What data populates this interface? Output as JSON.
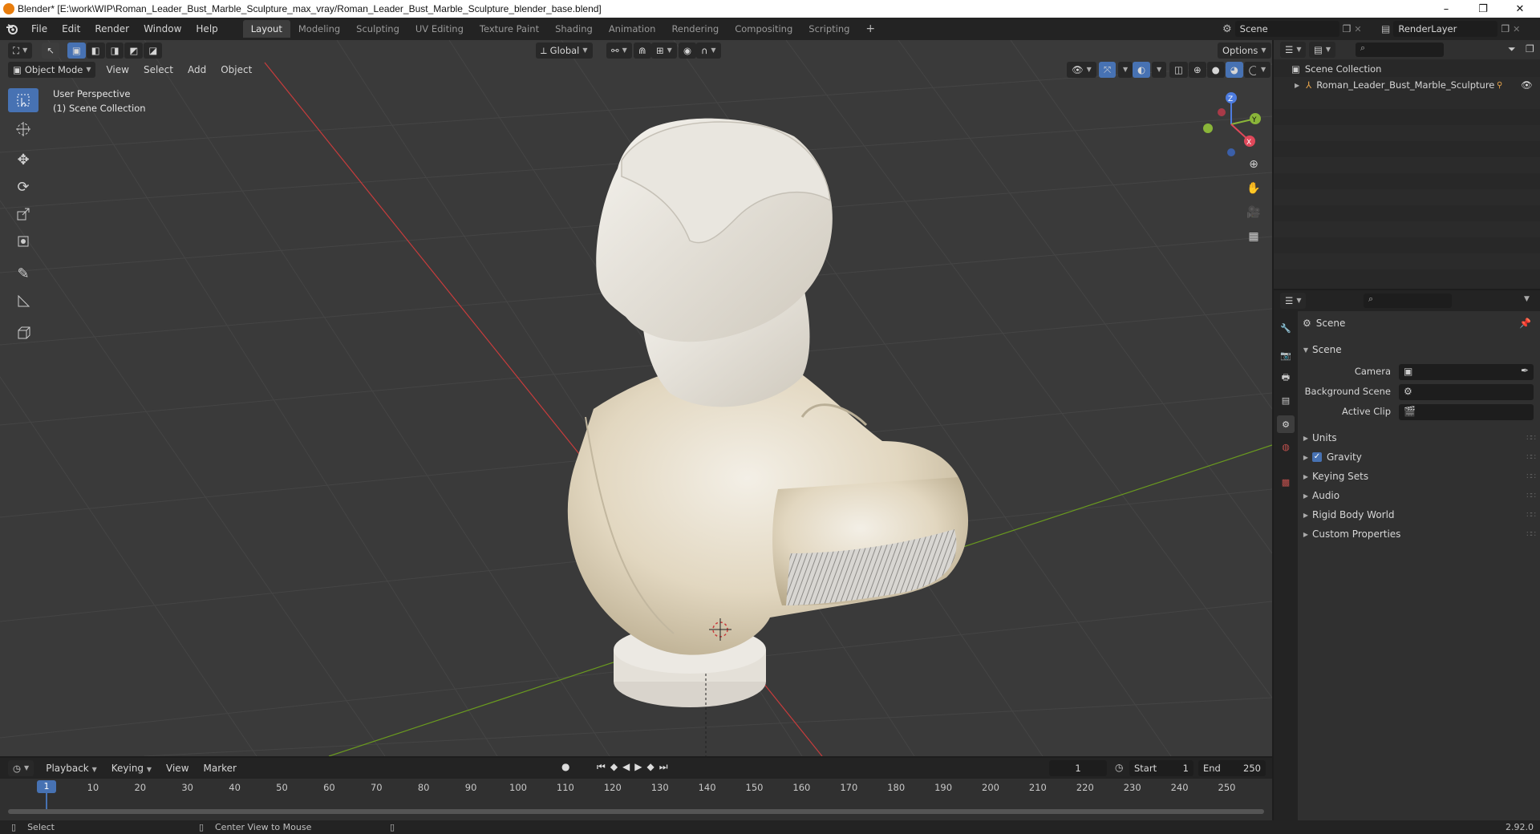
{
  "window": {
    "title": "Blender* [E:\\work\\WIP\\Roman_Leader_Bust_Marble_Sculpture_max_vray/Roman_Leader_Bust_Marble_Sculpture_blender_base.blend]",
    "minimize": "–",
    "maximize": "❐",
    "close": "✕"
  },
  "menubar": {
    "items": [
      "File",
      "Edit",
      "Render",
      "Window",
      "Help"
    ],
    "workspaces": [
      "Layout",
      "Modeling",
      "Sculpting",
      "UV Editing",
      "Texture Paint",
      "Shading",
      "Animation",
      "Rendering",
      "Compositing",
      "Scripting"
    ],
    "active_workspace": "Layout",
    "add_workspace": "+",
    "scene_name": "Scene",
    "render_layer": "RenderLayer"
  },
  "viewport": {
    "mode": "Object Mode",
    "menus": [
      "View",
      "Select",
      "Add",
      "Object"
    ],
    "orientation": "Global",
    "options_label": "Options",
    "overlay_text_1": "User Perspective",
    "overlay_text_2": "(1) Scene Collection",
    "gizmo": {
      "z": "Z",
      "y": "Y",
      "x": "X"
    }
  },
  "outliner": {
    "root": "Scene Collection",
    "items": [
      {
        "name": "Roman_Leader_Bust_Marble_Sculpture"
      }
    ]
  },
  "properties": {
    "context": "Scene",
    "panel_title": "Scene",
    "fields": [
      {
        "label": "Camera"
      },
      {
        "label": "Background Scene"
      },
      {
        "label": "Active Clip"
      }
    ],
    "subpanels": [
      {
        "label": "Units",
        "checkbox": false
      },
      {
        "label": "Gravity",
        "checkbox": true
      },
      {
        "label": "Keying Sets",
        "checkbox": false
      },
      {
        "label": "Audio",
        "checkbox": false
      },
      {
        "label": "Rigid Body World",
        "checkbox": false
      },
      {
        "label": "Custom Properties",
        "checkbox": false
      }
    ]
  },
  "timeline": {
    "menus": [
      "Playback",
      "Keying",
      "View",
      "Marker"
    ],
    "current_frame": "1",
    "start_label": "Start",
    "start_value": "1",
    "end_label": "End",
    "end_value": "250",
    "ruler": [
      "10",
      "20",
      "30",
      "40",
      "50",
      "60",
      "70",
      "80",
      "90",
      "100",
      "110",
      "120",
      "130",
      "140",
      "150",
      "160",
      "170",
      "180",
      "190",
      "200",
      "210",
      "220",
      "230",
      "240",
      "250"
    ],
    "playhead": "1"
  },
  "statusbar": {
    "left": "Select",
    "middle": "Center View to Mouse",
    "version": "2.92.0"
  },
  "colors": {
    "accent": "#4772b3",
    "viewport_bg": "#3a3a3a",
    "x_axis": "#c83c3c",
    "y_axis": "#6a9a1f"
  }
}
